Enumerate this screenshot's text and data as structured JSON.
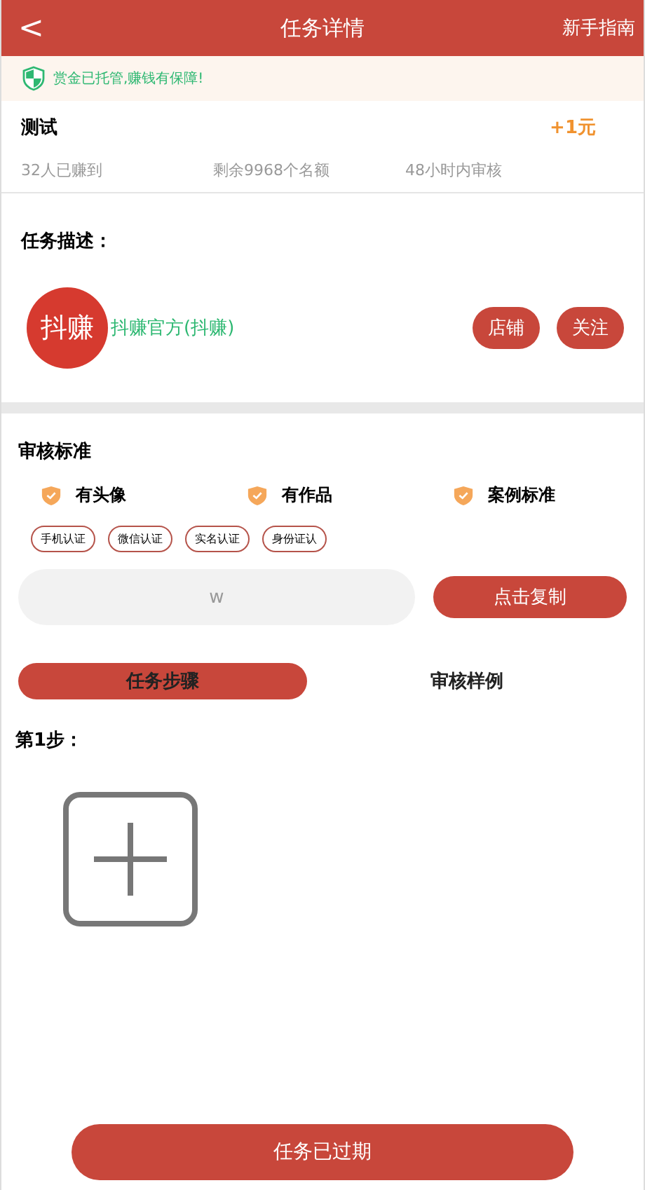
{
  "header": {
    "back": "<",
    "title": "任务详情",
    "guide": "新手指南"
  },
  "notice": "赏金已托管,赚钱有保障!",
  "task": {
    "name": "测试",
    "reward": "+1元",
    "stats": [
      "32人已赚到",
      "剩余9968个名额",
      "48小时内审核"
    ]
  },
  "description": {
    "title": "任务描述：",
    "avatar": "抖赚",
    "publisher": "抖赚官方(抖赚)",
    "buttons": [
      "店铺",
      "关注"
    ]
  },
  "review": {
    "title": "审核标准",
    "criteria": [
      "有头像",
      "有作品",
      "案例标准"
    ],
    "tags": [
      "手机认证",
      "微信认证",
      "实名认证",
      "身份证认"
    ],
    "copy_value": "w",
    "copy_button": "点击复制"
  },
  "tabs": [
    {
      "label": "任务步骤",
      "selected": true
    },
    {
      "label": "审核样例",
      "selected": false
    }
  ],
  "steps": [
    {
      "label": "第1步："
    }
  ],
  "footer_button": "任务已过期"
}
